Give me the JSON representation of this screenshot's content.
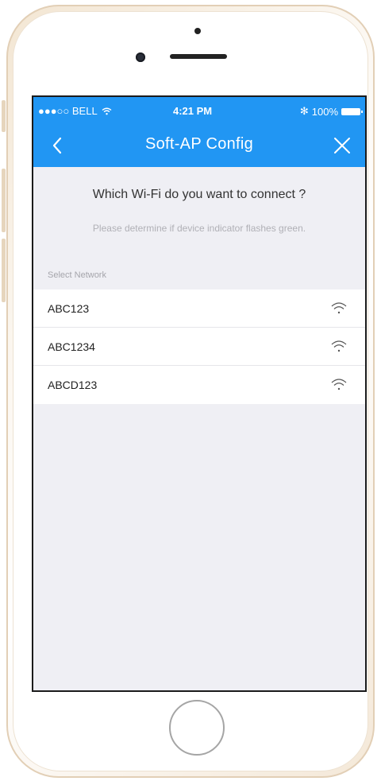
{
  "status_bar": {
    "carrier": "BELL",
    "signal_dots": "●●●○○",
    "wifi_glyph": "wifi-icon",
    "time": "4:21 PM",
    "bluetooth": "✻",
    "battery": "100%"
  },
  "nav": {
    "title": "Soft-AP Config",
    "back_icon": "chevron-left-icon",
    "close_icon": "close-icon"
  },
  "main": {
    "question": "Which Wi-Fi do you want to connect ?",
    "hint": "Please determine if device indicator flashes green.",
    "section_label": "Select Network",
    "networks": [
      {
        "name": "ABC123",
        "icon": "wifi-icon"
      },
      {
        "name": "ABC1234",
        "icon": "wifi-icon"
      },
      {
        "name": "ABCD123",
        "icon": "wifi-icon"
      }
    ]
  },
  "colors": {
    "accent": "#2196f3",
    "background": "#efeff4",
    "row_background": "#ffffff",
    "frame": "#e2cfb6"
  }
}
